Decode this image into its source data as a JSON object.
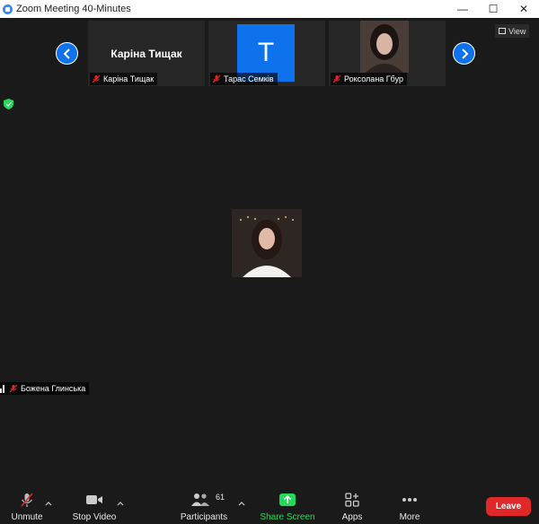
{
  "window": {
    "title": "Zoom Meeting 40-Minutes",
    "controls": {
      "minimize": "—",
      "maximize": "☐",
      "close": "✕"
    }
  },
  "thumbnails": [
    {
      "name": "Каріна Тищак",
      "display": "Каріна Тищак",
      "type": "name-only"
    },
    {
      "name": "Тарас Семків",
      "initial": "T",
      "type": "initial",
      "avatar_color": "#0e72ed"
    },
    {
      "name": "Роксолана Гбур",
      "type": "photo"
    }
  ],
  "view_button": {
    "label": "View"
  },
  "active_speaker": {
    "name": "Божена Глинська"
  },
  "toolbar": {
    "unmute": "Unmute",
    "stop_video": "Stop Video",
    "participants": "Participants",
    "participants_count": "61",
    "share_screen": "Share Screen",
    "apps": "Apps",
    "more": "More",
    "leave": "Leave"
  },
  "colors": {
    "accent": "#0e72ed",
    "share": "#23d959",
    "leave": "#e02828",
    "background": "#1a1a1a",
    "security": "#23d959"
  }
}
